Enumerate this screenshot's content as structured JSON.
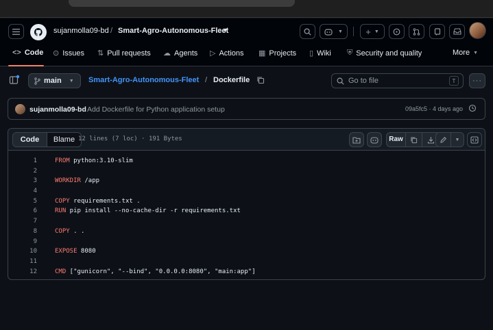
{
  "header": {
    "owner": "sujanmolla09-bd",
    "separator": "/",
    "repo": "Smart-Agro-Autonomous-Fleet"
  },
  "tabs": [
    {
      "label": "Code",
      "icon": "code-icon"
    },
    {
      "label": "Issues",
      "icon": "issue-icon"
    },
    {
      "label": "Pull requests",
      "icon": "pull-request-icon"
    },
    {
      "label": "Agents",
      "icon": "agents-icon"
    },
    {
      "label": "Actions",
      "icon": "play-icon"
    },
    {
      "label": "Projects",
      "icon": "table-icon"
    },
    {
      "label": "Wiki",
      "icon": "book-icon"
    },
    {
      "label": "Security and quality",
      "icon": "shield-icon"
    },
    {
      "label": "More",
      "icon": "triangle-down-icon"
    }
  ],
  "filebar": {
    "branch": "main",
    "repo_link": "Smart-Agro-Autonomous-Fleet",
    "separator": "/",
    "filename": "Dockerfile",
    "goto_placeholder": "Go to file",
    "goto_shortcut": "T"
  },
  "commit": {
    "author": "sujanmolla09-bd",
    "message": "Add Dockerfile for Python application setup",
    "meta": "09a5fc5 · 4 days ago"
  },
  "code": {
    "tab_code": "Code",
    "tab_blame": "Blame",
    "info": "12 lines (7 loc) · 191 Bytes",
    "raw_label": "Raw",
    "lines": [
      {
        "num": "1",
        "kw": "FROM",
        "rest": " python:3.10-slim"
      },
      {
        "num": "2",
        "kw": "",
        "rest": ""
      },
      {
        "num": "3",
        "kw": "WORKDIR",
        "rest": " /app"
      },
      {
        "num": "4",
        "kw": "",
        "rest": ""
      },
      {
        "num": "5",
        "kw": "COPY",
        "rest": " requirements.txt ."
      },
      {
        "num": "6",
        "kw": "RUN",
        "rest": " pip install --no-cache-dir -r requirements.txt"
      },
      {
        "num": "7",
        "kw": "",
        "rest": ""
      },
      {
        "num": "8",
        "kw": "COPY",
        "rest": " . ."
      },
      {
        "num": "9",
        "kw": "",
        "rest": ""
      },
      {
        "num": "10",
        "kw": "EXPOSE",
        "rest": " 8080"
      },
      {
        "num": "11",
        "kw": "",
        "rest": ""
      },
      {
        "num": "12",
        "kw": "CMD",
        "rest": " [\"gunicorn\", \"--bind\", \"0.0.0.0:8080\", \"main:app\"]"
      }
    ]
  },
  "colors": {
    "accent_link": "#4493f8",
    "keyword": "#ff7b72",
    "string": "#a5d6ff",
    "tab_underline": "#f78166"
  }
}
